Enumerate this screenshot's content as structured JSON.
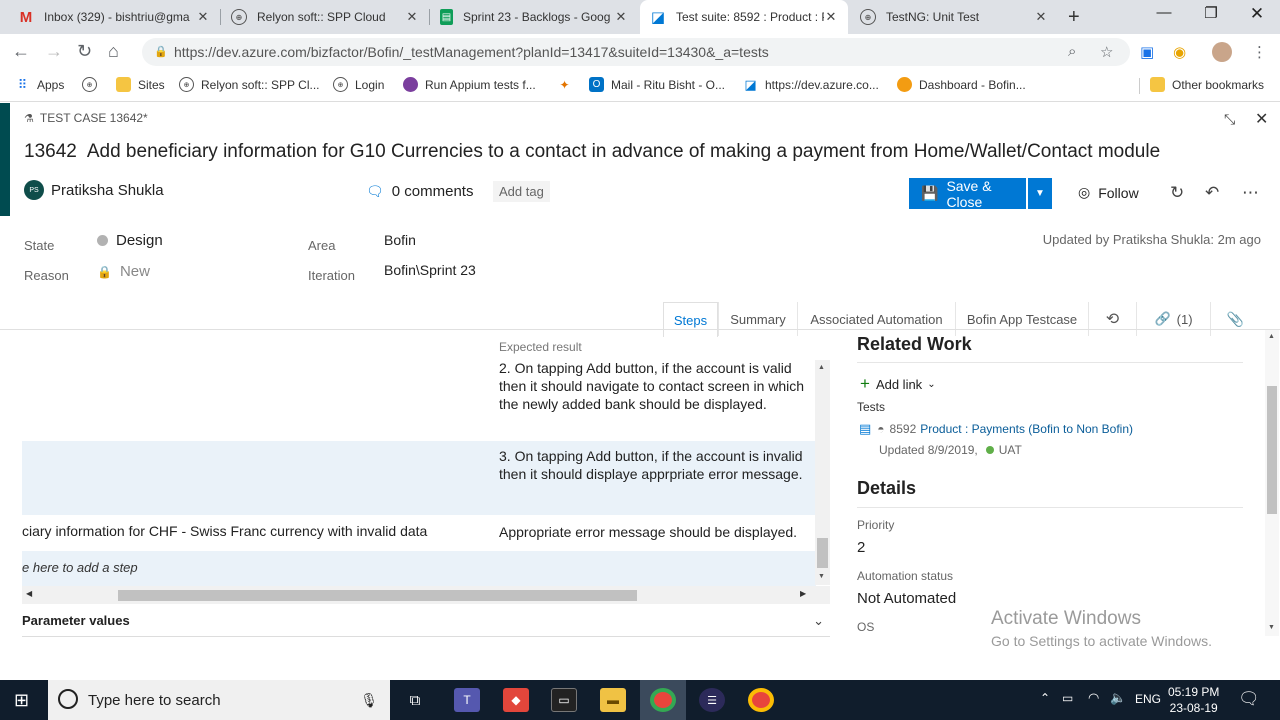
{
  "browser": {
    "tabs": [
      {
        "title": "Inbox (329) - bishtriu@gma",
        "icon": "gmail-icon",
        "active": false
      },
      {
        "title": "Relyon soft:: SPP Cloud",
        "icon": "globe-icon",
        "active": false
      },
      {
        "title": "Sprint 23 - Backlogs - Goog",
        "icon": "sheets-icon",
        "active": false
      },
      {
        "title": "Test suite: 8592 : Product : P",
        "icon": "azure-devops-icon",
        "active": true
      },
      {
        "title": "TestNG: Unit Test",
        "icon": "globe-icon",
        "active": false
      }
    ],
    "url": "https://dev.azure.com/bizfactor/Bofin/_testManagement?planId=13417&suiteId=13430&_a=tests",
    "bookmarks": [
      "Apps",
      "Sites",
      "Relyon soft:: SPP Cl...",
      "Login",
      "Run Appium tests f...",
      "Mail - Ritu Bisht - O...",
      "https://dev.azure.co...",
      "Dashboard - Bofin..."
    ],
    "other_bookmarks": "Other bookmarks"
  },
  "work_item": {
    "type_label": "TEST CASE 13642*",
    "id": "13642",
    "title": "Add beneficiary information for G10 Currencies to a contact in advance of making a payment from Home/Wallet/Contact module",
    "assignee": "Pratiksha Shukla",
    "assignee_initials": "PS",
    "comments": "0 comments",
    "add_tag": "Add tag",
    "save_label": "Save & Close",
    "follow_label": "Follow",
    "state_label": "State",
    "state_value": "Design",
    "reason_label": "Reason",
    "reason_value": "New",
    "area_label": "Area",
    "area_value": "Bofin",
    "iteration_label": "Iteration",
    "iteration_value": "Bofin\\Sprint 23",
    "updated": "Updated by Pratiksha Shukla: 2m ago",
    "tabs": [
      "Steps",
      "Summary",
      "Associated Automation",
      "Bofin App Testcase"
    ],
    "links_count": "(1)"
  },
  "steps": {
    "expected_header": "Expected result",
    "row1_expected": "2. On tapping Add button, if the account is valid then it should navigate to contact screen in which the newly added bank should be displayed.",
    "row2_expected": "3. On tapping Add button, if the account is invalid then it should displaye apprpriate error message.",
    "row3_action": "ciary information for CHF - Swiss Franc currency with invalid data",
    "row3_expected": "Appropriate error message should be displayed.",
    "add_step": "e here to add a step",
    "parameter_values": "Parameter values"
  },
  "related": {
    "title": "Related Work",
    "add_link": "Add link",
    "tests_label": "Tests",
    "test_id": "8592",
    "test_title": "Product : Payments (Bofin to Non Bofin)",
    "test_updated": "Updated 8/9/2019,",
    "test_state": "UAT",
    "details_title": "Details",
    "priority_label": "Priority",
    "priority_value": "2",
    "automation_label": "Automation status",
    "automation_value": "Not Automated",
    "os_label": "OS"
  },
  "watermark": {
    "line1": "Activate Windows",
    "line2": "Go to Settings to activate Windows."
  },
  "taskbar": {
    "search_placeholder": "Type here to search",
    "lang": "ENG",
    "time": "05:19 PM",
    "date": "23-08-19"
  },
  "colors": {
    "accent": "#0078d4",
    "header_bar": "#004b50",
    "state_dot": "#b2b2b2",
    "uat_dot": "#60af49"
  }
}
